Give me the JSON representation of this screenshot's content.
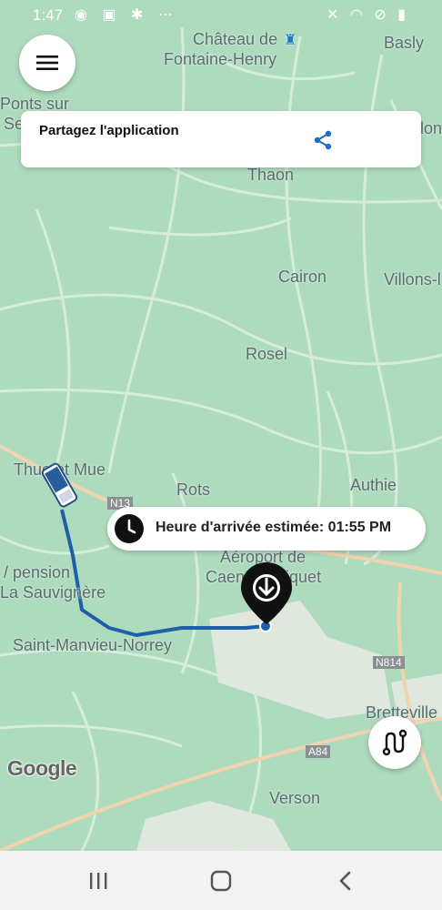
{
  "status_bar": {
    "time": "1:47",
    "left_icons": "◉ ▣ ✱ ⋯",
    "right_icons": "✕ ◠ ⊘ ▮"
  },
  "map": {
    "places": [
      {
        "name": "Château de",
        "key": "chateau1"
      },
      {
        "name": "Fontaine-Henry",
        "key": "chateau2"
      },
      {
        "name": "Basly",
        "key": "basly"
      },
      {
        "name": "Ponts sur",
        "key": "ponts1"
      },
      {
        "name": "Se",
        "key": "ponts2"
      },
      {
        "name": "lon",
        "key": "lon"
      },
      {
        "name": "Thaon",
        "key": "thaon"
      },
      {
        "name": "Cairon",
        "key": "cairon"
      },
      {
        "name": "Villons-l",
        "key": "villons"
      },
      {
        "name": "Rosel",
        "key": "rosel"
      },
      {
        "name": "Thue et Mue",
        "key": "thue"
      },
      {
        "name": "Rots",
        "key": "rots"
      },
      {
        "name": "Authie",
        "key": "authie"
      },
      {
        "name": "/ pension",
        "key": "pension"
      },
      {
        "name": "La Sauvignère",
        "key": "sauvignere"
      },
      {
        "name": "Aéroport de",
        "key": "aeroport1"
      },
      {
        "name": "Caen-Carpiquet",
        "key": "aeroport2"
      },
      {
        "name": "Saint-Manvieu-Norrey",
        "key": "saintmanvieu"
      },
      {
        "name": "Bretteville",
        "key": "bretteville"
      },
      {
        "name": "Verson",
        "key": "verson"
      }
    ],
    "road_labels": [
      "N13",
      "N814",
      "A84"
    ],
    "attribution": "Google"
  },
  "share_card": {
    "title": "Partagez l'application",
    "icon": "share-icon"
  },
  "eta": {
    "text": "Heure d'arrivée estimée: 01:55 PM",
    "icon": "clock-icon"
  },
  "colors": {
    "route": "#1f5fa8",
    "map_bg": "#aedbbd",
    "road": "#d8eedd",
    "major_road": "#f3d9b8"
  },
  "nav_bar": {
    "recents": "recents-icon",
    "home": "home-icon",
    "back": "back-icon"
  }
}
